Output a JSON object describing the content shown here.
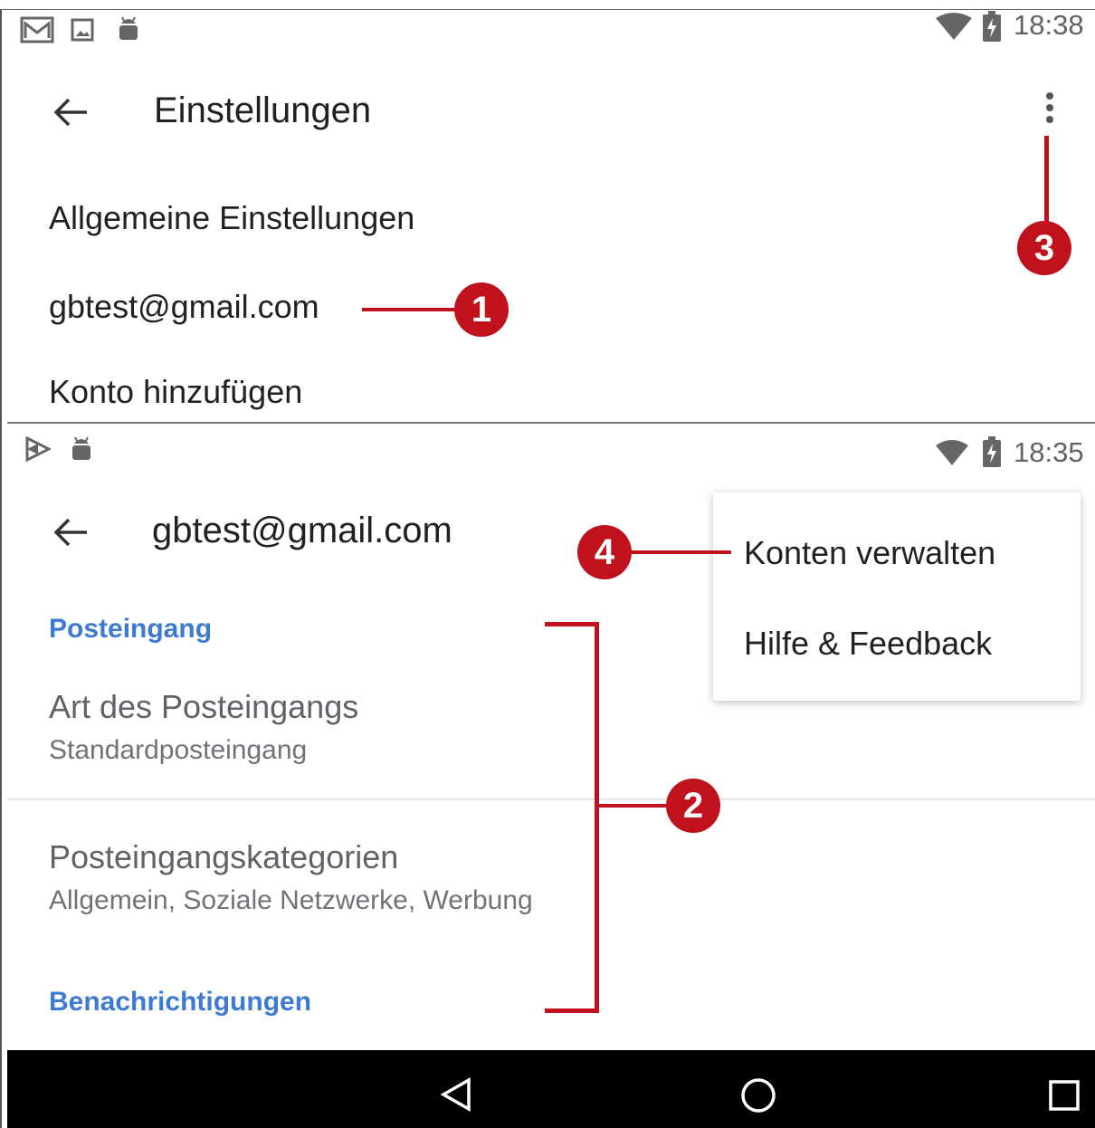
{
  "top_screen": {
    "status": {
      "time": "18:38",
      "icons": [
        "gmail-icon",
        "image-icon",
        "android-icon",
        "wifi-icon",
        "battery-icon"
      ]
    },
    "title": "Einstellungen",
    "items": [
      "Allgemeine Einstellungen",
      "gbtest@gmail.com",
      "Konto hinzufügen"
    ]
  },
  "bottom_screen": {
    "status": {
      "time": "18:35",
      "icons": [
        "play-store-icon",
        "android-icon",
        "wifi-icon",
        "battery-icon"
      ]
    },
    "title": "gbtest@gmail.com",
    "sections": [
      {
        "header": "Posteingang"
      },
      {
        "header": "Benachrichtigungen"
      }
    ],
    "prefs": [
      {
        "title": "Art des Posteingangs",
        "summary": "Standardposteingang"
      },
      {
        "title": "Posteingangskategorien",
        "summary": "Allgemein, Soziale Netzwerke, Werbung"
      }
    ],
    "menu": [
      "Konten verwalten",
      "Hilfe & Feedback"
    ]
  },
  "callouts": [
    "1",
    "2",
    "3",
    "4"
  ],
  "navbar": {
    "icons": [
      "back-icon",
      "home-icon",
      "recents-icon"
    ]
  },
  "colors": {
    "section": "#3c7bd1",
    "callout": "#c0121c",
    "navbar": "#000000"
  }
}
